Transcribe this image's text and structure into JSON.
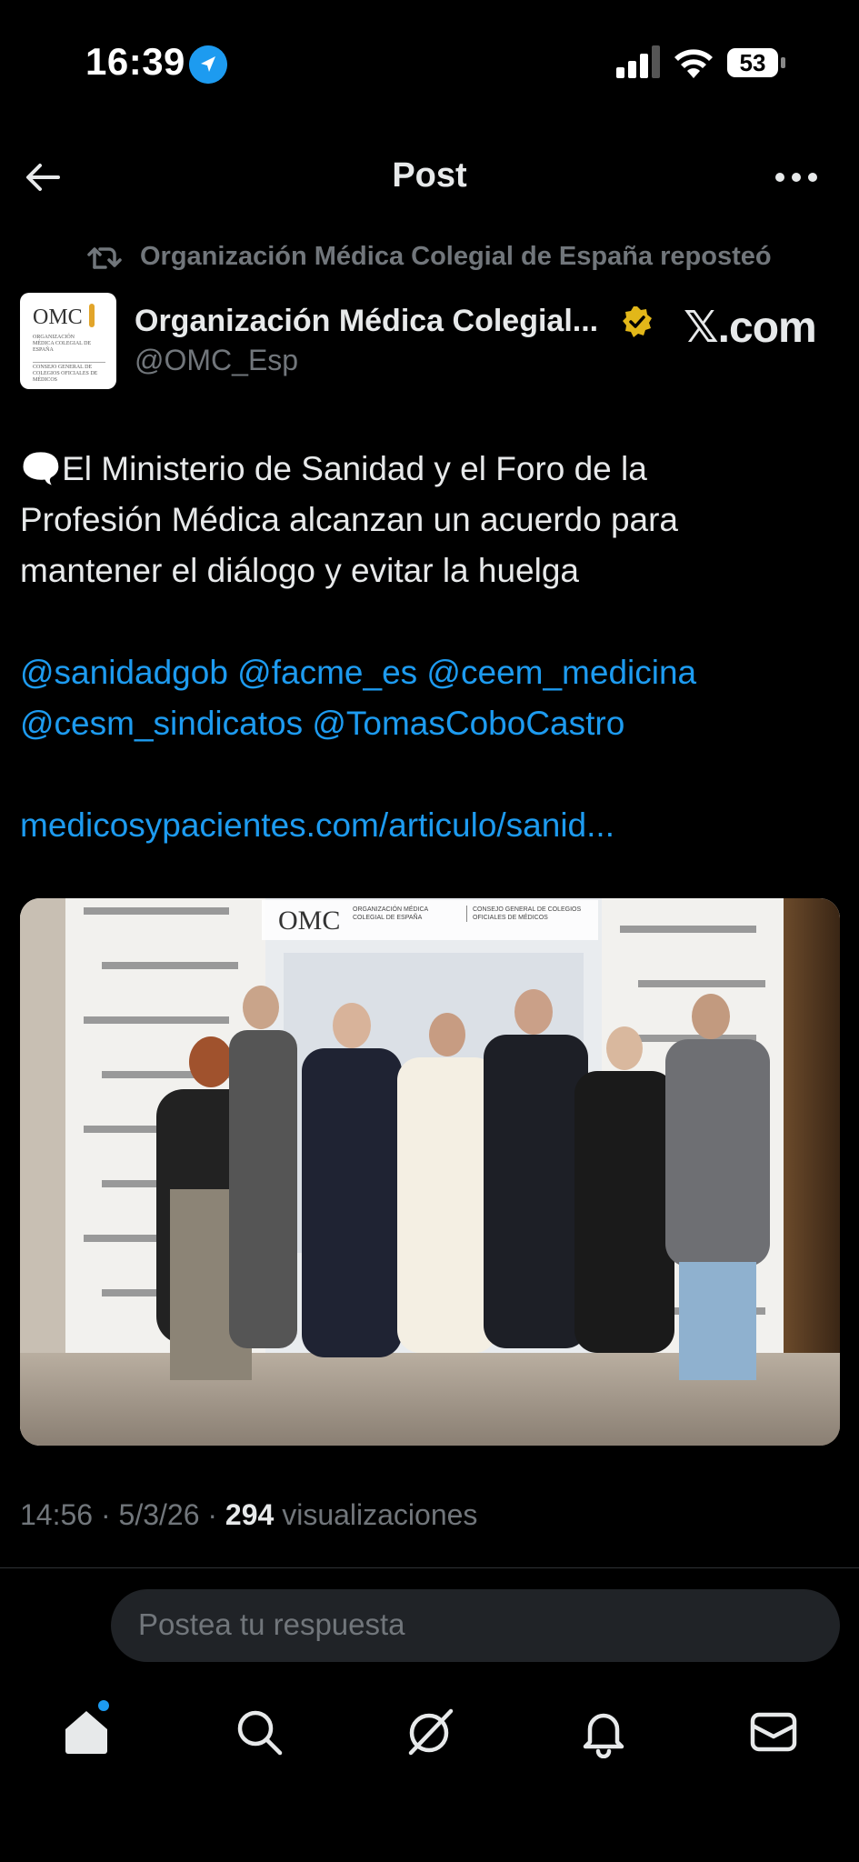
{
  "status_bar": {
    "time": "16:39",
    "battery": "53"
  },
  "header": {
    "title": "Post"
  },
  "repost": {
    "text": "Organización Médica Colegial de España reposteó"
  },
  "author": {
    "name": "Organización Médica Colegial...",
    "handle": "@OMC_Esp",
    "avatar_text": "OMC",
    "avatar_sub1": "ORGANIZACIÓN MÉDICA COLEGIAL DE ESPAÑA",
    "avatar_sub2": "CONSEJO GENERAL DE COLEGIOS OFICIALES DE MÉDICOS",
    "source": "𝕏.com"
  },
  "post": {
    "emoji": "🗨️",
    "line1": "El Ministerio de Sanidad y el Foro de la",
    "line2": "Profesión Médica alcanzan un acuerdo para",
    "line3": "mantener el diálogo y evitar la huelga",
    "mentions_line1": "@sanidadgob @facme_es @ceem_medicina",
    "mentions_line2": "@cesm_sindicatos @TomasCoboCastro",
    "link": "medicosypacientes.com/articulo/sanid..."
  },
  "photo": {
    "banner_logo": "OMC",
    "banner_line1": "ORGANIZACIÓN MÉDICA COLEGIAL DE ESPAÑA",
    "banner_line2": "CONSEJO GENERAL DE COLEGIOS OFICIALES DE MÉDICOS"
  },
  "meta": {
    "time": "14:56",
    "date": "5/3/26",
    "views": "294",
    "views_label": "visualizaciones"
  },
  "reply": {
    "placeholder": "Postea tu respuesta"
  },
  "icons": {
    "back": "arrow-left-icon",
    "more": "more-icon",
    "repost": "repost-icon",
    "verified": "verified-badge-icon",
    "home": "home-icon",
    "search": "search-icon",
    "grok": "grok-icon",
    "notifications": "bell-icon",
    "messages": "mail-icon"
  },
  "colors": {
    "accent": "#1d9bf0",
    "verified": "#e2b719",
    "background": "#000000",
    "muted": "#71767b"
  }
}
